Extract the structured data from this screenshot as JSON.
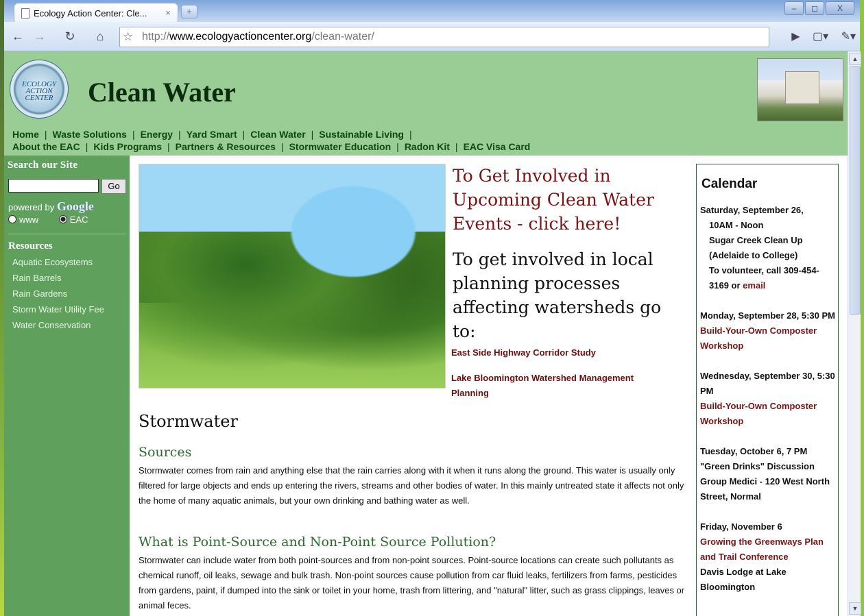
{
  "browser": {
    "tab_title": "Ecology Action Center: Cle...",
    "tab_close": "×",
    "new_tab": "+",
    "win_min": "–",
    "win_max": "◻",
    "win_close": "X",
    "url_prefix": "http://",
    "url_host": "www.ecologyactioncenter.org",
    "url_path": "/clean-water/"
  },
  "header": {
    "logo_text": "ECOLOGY ACTION CENTER",
    "title": "Clean Water",
    "nav_row1": [
      "Home",
      "Waste Solutions",
      "Energy",
      "Yard Smart",
      "Clean Water",
      "Sustainable Living"
    ],
    "nav_row2": [
      "About the EAC",
      "Kids Programs",
      "Partners & Resources",
      "Stormwater Education",
      "Radon Kit",
      "EAC Visa Card"
    ]
  },
  "sidebar": {
    "search_heading": "Search our Site",
    "go_label": "Go",
    "powered_by": "powered by",
    "google": "Google",
    "radio_www": "www",
    "radio_eac": "EAC",
    "resources_heading": "Resources",
    "resources": [
      "Aquatic Ecosystems",
      "Rain Barrels",
      "Rain Gardens",
      "Storm Water Utility Fee",
      "Water Conservation"
    ]
  },
  "main": {
    "cta_events": "To Get Involved in Upcoming Clean Water Events - click here!",
    "cta_planning": "To get involved in local planning processes affecting watersheds go to:",
    "link_highway": "East Side Highway Corridor Study",
    "link_lake": "Lake Bloomington Watershed Management Planning",
    "heading_stormwater": "Stormwater",
    "heading_sources": "Sources",
    "para_sources": "Stormwater comes from rain and anything else that the rain carries along with it when it runs along the ground. This water is usually only filtered for large objects and ends up entering the rivers, streams and other bodies of water. In this mainly untreated state it affects not only the home of many aquatic animals, but your own drinking and bathing water as well.",
    "heading_pollution": "What is Point-Source and Non-Point Source Pollution?",
    "para_pollution": "Stormwater can include water from both point-sources and from non-point sources. Point-source locations can create such pollutants as chemical runoff, oil leaks, sewage and bulk trash. Non-point sources cause pollution from car fluid leaks, fertilizers from farms, pesticides from gardens, paint, if dumped into the sink or toilet in your home, trash from littering, and \"natural\" litter, such as grass clippings, leaves or animal feces."
  },
  "calendar": {
    "title": "Calendar",
    "events": [
      {
        "line1": "Saturday, September 26,",
        "line2": "10AM - Noon",
        "line3": "Sugar Creek Clean Up (Adelaide to College)",
        "line4": "To volunteer, call 309-454-3169 or",
        "link": "email"
      },
      {
        "date": "Monday, September 28, 5:30 PM",
        "title": "Build-Your-Own Composter Workshop"
      },
      {
        "date": "Wednesday, September 30, 5:30 PM",
        "title": "Build-Your-Own Composter Workshop"
      },
      {
        "date": "Tuesday, October 6, 7 PM",
        "detail": "\"Green Drinks\" Discussion Group Medici - 120 West North Street, Normal"
      },
      {
        "date": "Friday, November 6",
        "title": "Growing the Greenways Plan and Trail Conference",
        "detail": "Davis Lodge at Lake Bloomington"
      }
    ]
  }
}
